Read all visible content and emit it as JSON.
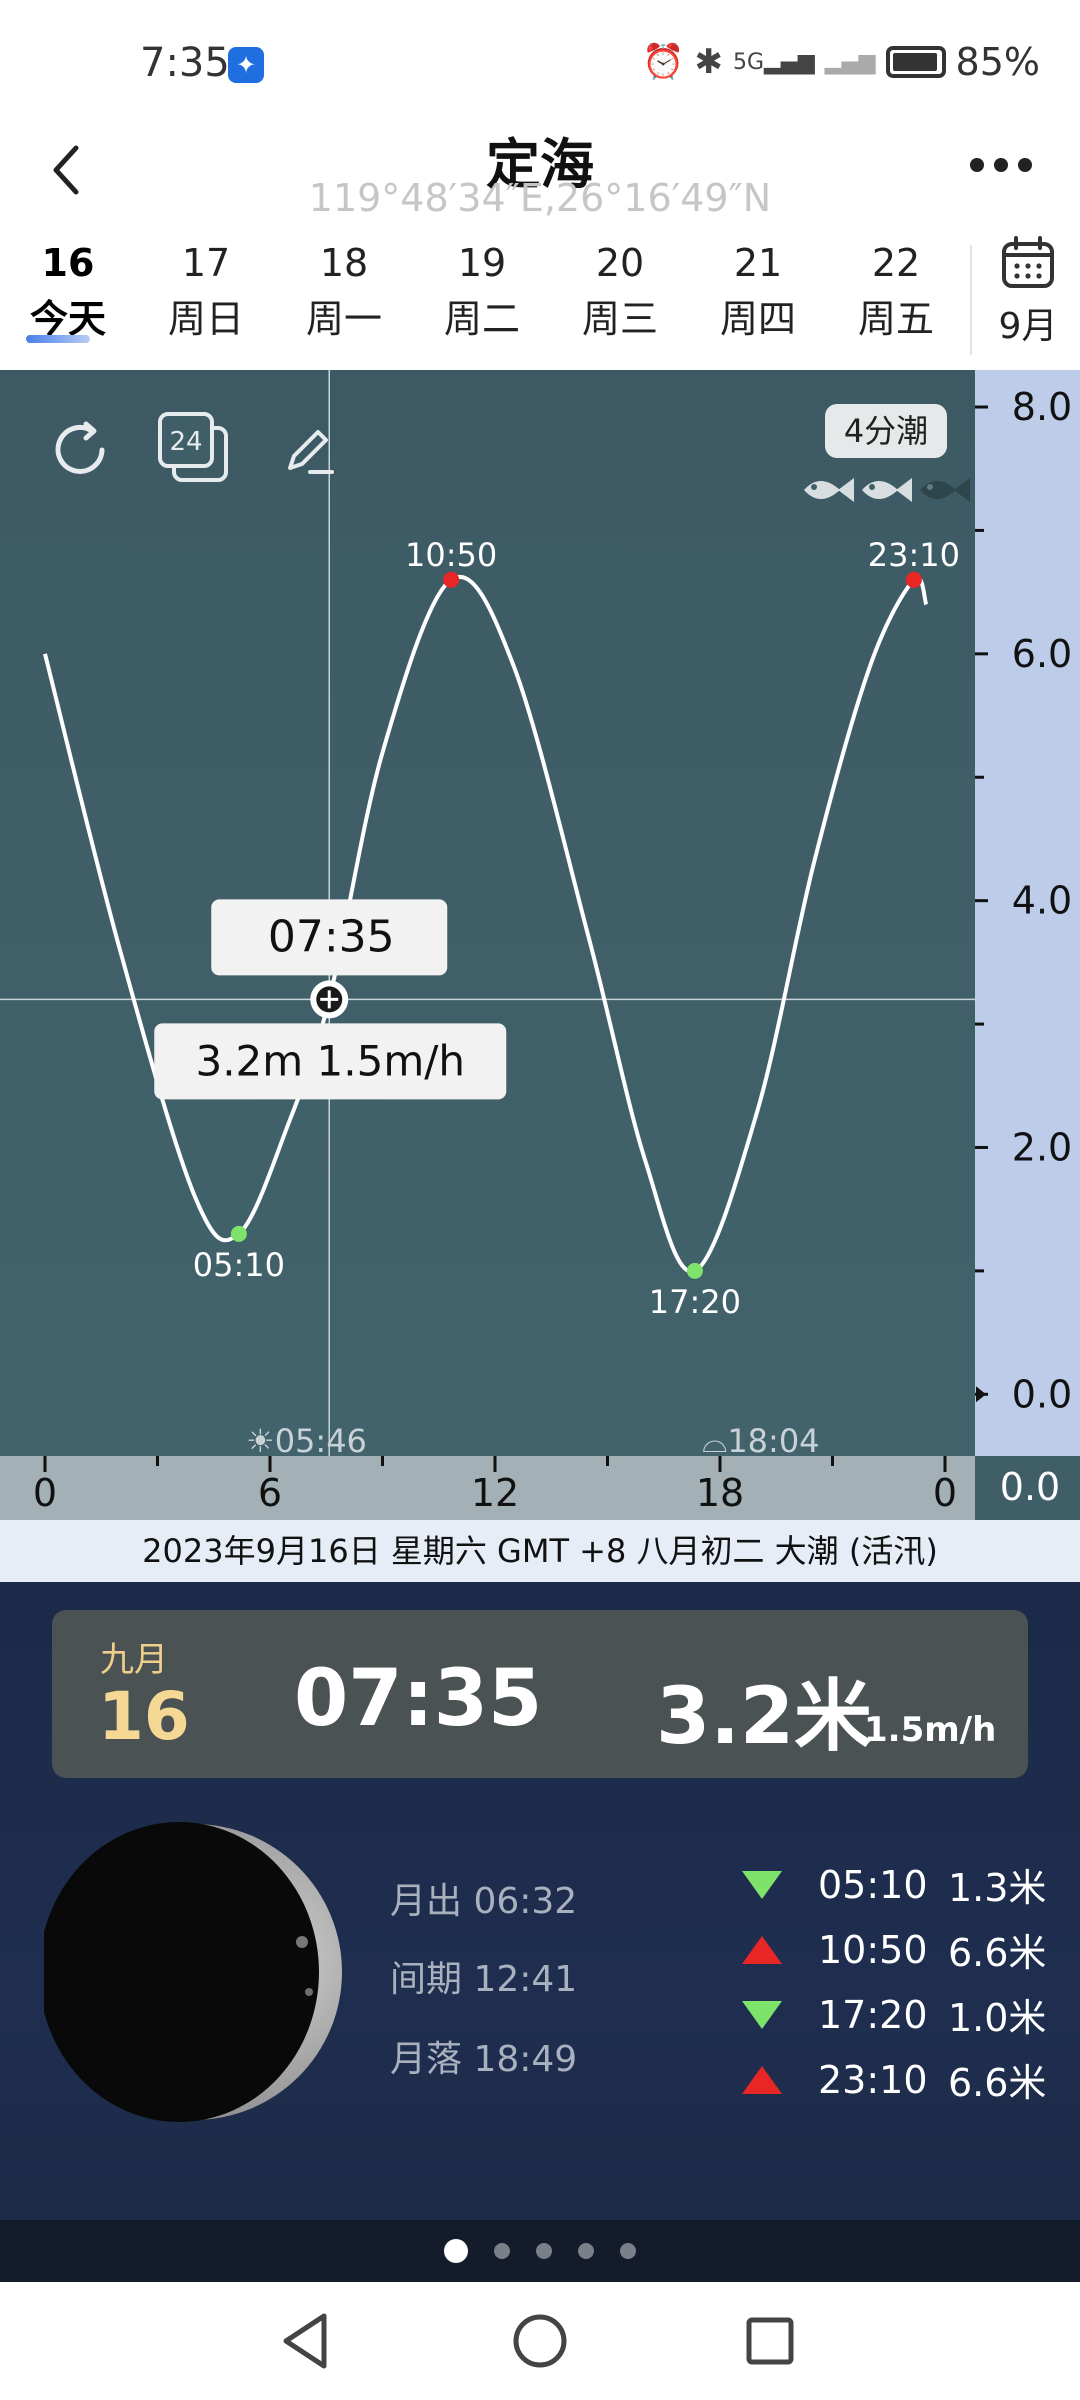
{
  "status_bar": {
    "time": "7:35",
    "battery": "85%"
  },
  "header": {
    "title": "定海",
    "coords": "119°48′34″E,26°16′49″N"
  },
  "date_strip": {
    "days": [
      {
        "num": "16",
        "label": "今天",
        "active": true
      },
      {
        "num": "17",
        "label": "周日"
      },
      {
        "num": "18",
        "label": "周一"
      },
      {
        "num": "19",
        "label": "周二"
      },
      {
        "num": "20",
        "label": "周三"
      },
      {
        "num": "21",
        "label": "周四"
      },
      {
        "num": "22",
        "label": "周五"
      }
    ],
    "calendar_label": "9月"
  },
  "chart": {
    "tool_24": "24",
    "tide_badge": "4分潮",
    "y_ticks": [
      "8.0",
      "6.0",
      "4.0",
      "2.0",
      "0.0"
    ],
    "y_ticks_values": [
      8,
      6,
      4,
      2,
      0
    ],
    "y_base_label": "0.0",
    "x_ticks": [
      "0",
      "6",
      "12",
      "18",
      "0"
    ],
    "x_ticks_values": [
      0,
      6,
      12,
      18,
      24
    ],
    "sunrise": "05:46",
    "sunset": "18:04",
    "cursor_time": "07:35",
    "cursor_height": "3.2m",
    "cursor_rate": "1.5m/h",
    "extremes": [
      {
        "time": "05:10",
        "kind": "low"
      },
      {
        "time": "10:50",
        "kind": "high"
      },
      {
        "time": "17:20",
        "kind": "low"
      },
      {
        "time": "23:10",
        "kind": "high"
      }
    ]
  },
  "chart_data": {
    "type": "line",
    "title": "",
    "xlabel": "",
    "ylabel": "",
    "xlim": [
      0,
      24
    ],
    "ylim": [
      -0.5,
      8.3
    ],
    "series": [
      {
        "x": [
          0,
          2,
          4,
          5.17,
          6.5,
          7.58,
          9,
          10.83,
          12.5,
          14.5,
          16,
          17.33,
          19,
          20.5,
          22,
          23.17,
          23.5
        ],
        "y": [
          6.0,
          3.6,
          1.6,
          1.3,
          2.2,
          3.2,
          5.2,
          6.6,
          5.9,
          3.7,
          1.9,
          1.0,
          2.3,
          4.3,
          5.9,
          6.6,
          6.4
        ]
      }
    ],
    "markers": [
      {
        "x": 5.17,
        "y": 1.3,
        "label": "05:10",
        "color": "#7ee36a"
      },
      {
        "x": 10.83,
        "y": 6.6,
        "label": "10:50",
        "color": "#e82626"
      },
      {
        "x": 17.33,
        "y": 1.0,
        "label": "17:20",
        "color": "#7ee36a"
      },
      {
        "x": 23.17,
        "y": 6.6,
        "label": "23:10",
        "color": "#e82626"
      }
    ],
    "cursor": {
      "x": 7.58,
      "y": 3.2
    }
  },
  "info_line": "2023年9月16日  星期六  GMT +8  八月初二  大潮 (活汛)",
  "summary": {
    "month": "九月",
    "day": "16",
    "time": "07:35",
    "height": "3.2米",
    "rate": "1.5m/h"
  },
  "moon": {
    "rise": "月出 06:32",
    "interval": "间期 12:41",
    "set": "月落 18:49"
  },
  "tide_table": [
    {
      "kind": "low",
      "time": "05:10",
      "height": "1.3米"
    },
    {
      "kind": "high",
      "time": "10:50",
      "height": "6.6米"
    },
    {
      "kind": "low",
      "time": "17:20",
      "height": "1.0米"
    },
    {
      "kind": "high",
      "time": "23:10",
      "height": "6.6米"
    }
  ],
  "colors": {
    "chart_bg": "#3f5e67",
    "axis_bg": "#bccce9",
    "high_marker": "#e82626",
    "low_marker": "#7ee36a",
    "bottom_bg": "#1f2e4f",
    "accent_gold": "#f4d894"
  },
  "pager": {
    "pages": 5,
    "active": 0
  }
}
